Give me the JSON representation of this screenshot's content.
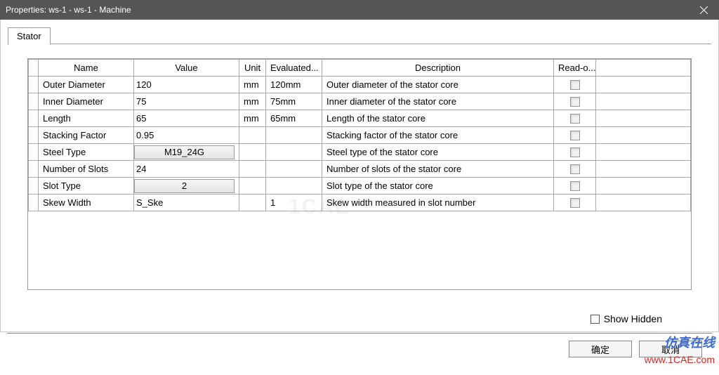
{
  "title": "Properties: ws-1 - ws-1 - Machine",
  "tab": "Stator",
  "headers": {
    "name": "Name",
    "value": "Value",
    "unit": "Unit",
    "evaluated": "Evaluated...",
    "description": "Description",
    "readonly": "Read-o..."
  },
  "rows": [
    {
      "name": "Outer Diameter",
      "value": "120",
      "value_type": "text",
      "unit": "mm",
      "evaluated": "120mm",
      "desc": "Outer diameter of the stator core"
    },
    {
      "name": "Inner Diameter",
      "value": "75",
      "value_type": "text",
      "unit": "mm",
      "evaluated": "75mm",
      "desc": "Inner diameter of the stator core"
    },
    {
      "name": "Length",
      "value": "65",
      "value_type": "text",
      "unit": "mm",
      "evaluated": "65mm",
      "desc": "Length of the stator core"
    },
    {
      "name": "Stacking Factor",
      "value": "0.95",
      "value_type": "text",
      "unit": "",
      "evaluated": "",
      "desc": "Stacking factor of the stator core"
    },
    {
      "name": "Steel Type",
      "value": "M19_24G",
      "value_type": "button",
      "unit": "",
      "evaluated": "",
      "desc": "Steel type of the stator core"
    },
    {
      "name": "Number of Slots",
      "value": "24",
      "value_type": "text",
      "unit": "",
      "evaluated": "",
      "desc": "Number of slots of the stator core"
    },
    {
      "name": "Slot Type",
      "value": "2",
      "value_type": "button",
      "unit": "",
      "evaluated": "",
      "desc": "Slot type of the stator core"
    },
    {
      "name": "Skew Width",
      "value": "S_Ske",
      "value_type": "text",
      "unit": "",
      "evaluated": "1",
      "desc": "Skew width measured in slot number"
    }
  ],
  "show_hidden_label": "Show Hidden",
  "ok_label": "确定",
  "cancel_label": "取消",
  "watermark_top": "仿真在线",
  "watermark_bottom": "www.1CAE.com",
  "watermark_center": "1CAE"
}
